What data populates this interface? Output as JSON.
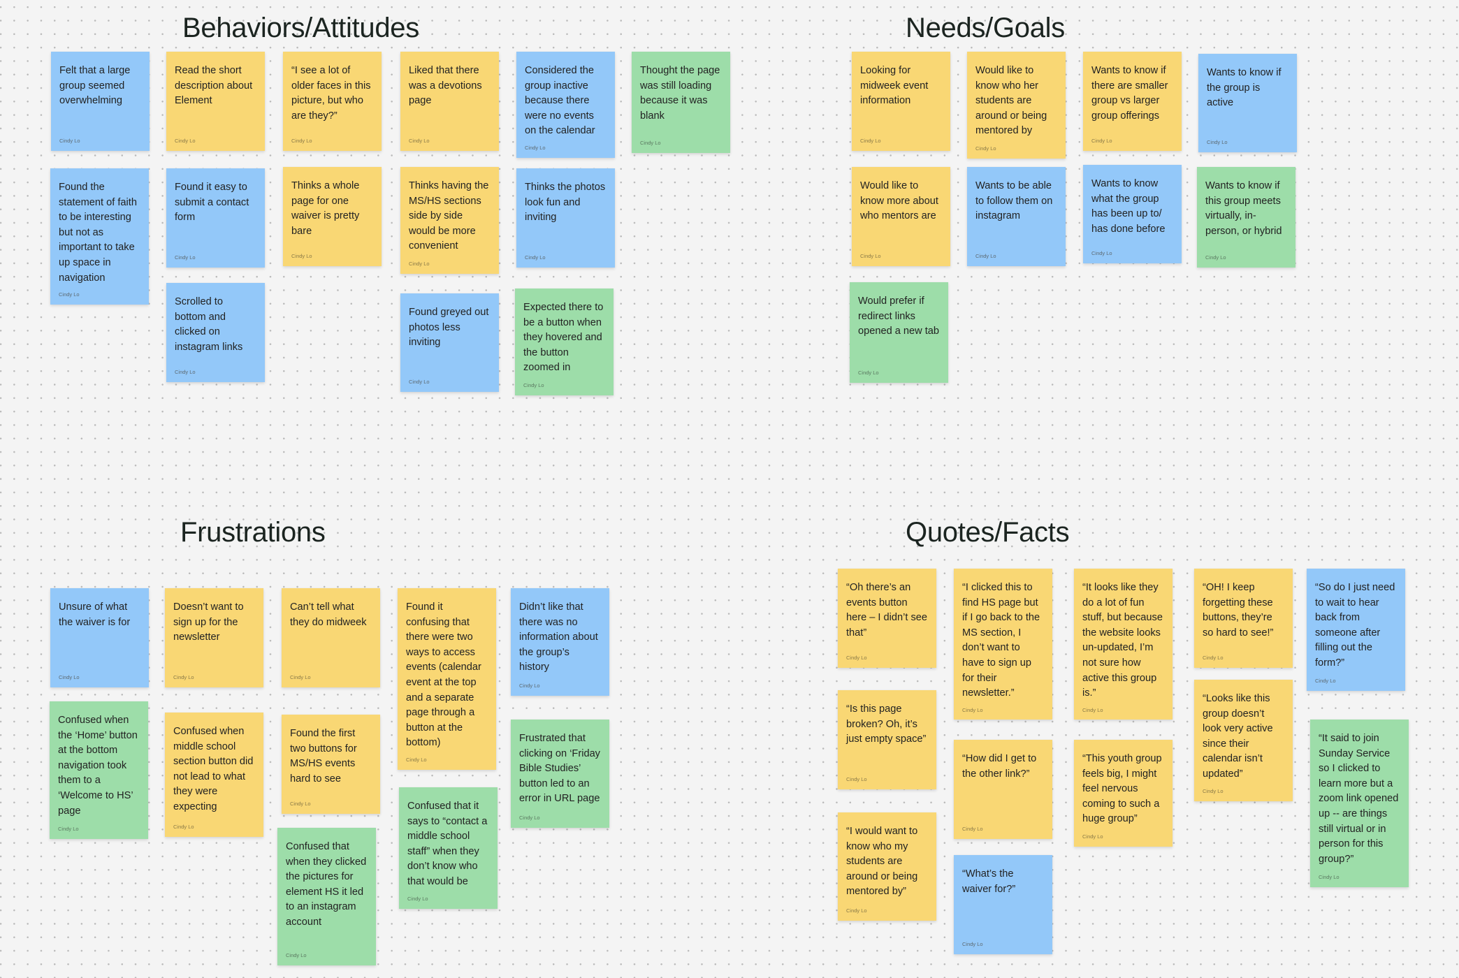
{
  "board": {
    "author": "Cindy Lo",
    "colors": {
      "blue": "#93c8f9",
      "yellow": "#f9d774",
      "green": "#9ddda9",
      "background": "#f4f4f4"
    }
  },
  "sections": [
    {
      "id": "behaviors",
      "title": "Behaviors/Attitudes",
      "notes": [
        {
          "color": "blue",
          "text": "Felt that a large group seemed overwhelming"
        },
        {
          "color": "yellow",
          "text": "Read the short description about Element"
        },
        {
          "color": "yellow",
          "text": "“I see a lot of older faces in this picture, but who are they?”"
        },
        {
          "color": "yellow",
          "text": "Liked that there was a devotions page"
        },
        {
          "color": "blue",
          "text": "Considered the group inactive because there were no events on the calendar"
        },
        {
          "color": "green",
          "text": "Thought the page was still loading because it was blank"
        },
        {
          "color": "blue",
          "text": "Found the statement of faith to be interesting but not as important to take up space in navigation"
        },
        {
          "color": "blue",
          "text": "Found it easy to submit a contact form"
        },
        {
          "color": "yellow",
          "text": "Thinks a whole page for one waiver is pretty bare"
        },
        {
          "color": "yellow",
          "text": "Thinks having the MS/HS sections side by side would be more convenient"
        },
        {
          "color": "blue",
          "text": "Thinks the photos look fun and inviting"
        },
        {
          "color": "blue",
          "text": "Scrolled to bottom and clicked on instagram links"
        },
        {
          "color": "blue",
          "text": "Found greyed out photos less inviting"
        },
        {
          "color": "green",
          "text": "Expected there to be a button when they hovered and the button zoomed in"
        }
      ]
    },
    {
      "id": "needs",
      "title": "Needs/Goals",
      "notes": [
        {
          "color": "yellow",
          "text": "Looking for midweek event information"
        },
        {
          "color": "yellow",
          "text": "Would like to know who her students are around or being mentored by"
        },
        {
          "color": "yellow",
          "text": "Wants to know if there are smaller group vs larger group offerings"
        },
        {
          "color": "blue",
          "text": "Wants to know if the group is active"
        },
        {
          "color": "yellow",
          "text": "Would like to know more about who mentors are"
        },
        {
          "color": "blue",
          "text": "Wants to be able to follow them on instagram"
        },
        {
          "color": "blue",
          "text": "Wants to know what the group has been up to/ has done before"
        },
        {
          "color": "green",
          "text": "Wants to know if this group meets virtually, in-person, or hybrid"
        },
        {
          "color": "green",
          "text": "Would prefer if redirect links opened a new tab"
        }
      ]
    },
    {
      "id": "frustrations",
      "title": "Frustrations",
      "notes": [
        {
          "color": "blue",
          "text": "Unsure of what the waiver is for"
        },
        {
          "color": "yellow",
          "text": "Doesn’t want to sign up for the newsletter"
        },
        {
          "color": "yellow",
          "text": "Can’t tell what they do midweek"
        },
        {
          "color": "yellow",
          "text": "Found it confusing that there were two ways to access events (calendar event at the top and a separate page through a button at the bottom)"
        },
        {
          "color": "blue",
          "text": "Didn’t like that there was no information about the group’s history"
        },
        {
          "color": "green",
          "text": "Confused when the ‘Home’ button at the bottom navigation took them to a ‘Welcome to HS’ page"
        },
        {
          "color": "yellow",
          "text": "Confused when middle school section button did not lead to what they were expecting"
        },
        {
          "color": "yellow",
          "text": "Found the first two buttons for MS/HS events hard to see"
        },
        {
          "color": "green",
          "text": "Frustrated that clicking on ‘Friday Bible Studies’ button led to an error in URL page"
        },
        {
          "color": "green",
          "text": "Confused that when they clicked the pictures for element HS it led to an instagram account"
        },
        {
          "color": "green",
          "text": "Confused that it says to “contact a middle school staff” when they don’t know who that would be"
        }
      ]
    },
    {
      "id": "quotes",
      "title": "Quotes/Facts",
      "notes": [
        {
          "color": "yellow",
          "text": "“Oh there’s an events button here – I didn’t see that”"
        },
        {
          "color": "yellow",
          "text": "“I clicked this to find HS page but if I go back to the MS section, I don’t want to have to sign up for their newsletter.”"
        },
        {
          "color": "yellow",
          "text": "“It looks like they do a lot of fun stuff, but because the website looks un-updated, I’m not sure how active this group is.”"
        },
        {
          "color": "yellow",
          "text": "“OH! I keep forgetting these buttons, they’re so hard to see!”"
        },
        {
          "color": "blue",
          "text": "“So do I just need to wait to hear back from someone after filling out the form?”"
        },
        {
          "color": "yellow",
          "text": "“Is this page broken? Oh, it’s just empty space”"
        },
        {
          "color": "yellow",
          "text": "“Looks like this group doesn’t look very active since their calendar isn’t updated”"
        },
        {
          "color": "yellow",
          "text": "“How did I get to the other link?”"
        },
        {
          "color": "yellow",
          "text": "“This youth group feels big, I might feel nervous coming to such a huge group”"
        },
        {
          "color": "green",
          "text": "“It said to join Sunday Service so I clicked to learn more but a zoom link opened up -- are things still virtual or in person for this group?”"
        },
        {
          "color": "yellow",
          "text": "“I would want to know who my students are around or being mentored by”"
        },
        {
          "color": "blue",
          "text": "“What’s the waiver for?”"
        }
      ]
    }
  ]
}
